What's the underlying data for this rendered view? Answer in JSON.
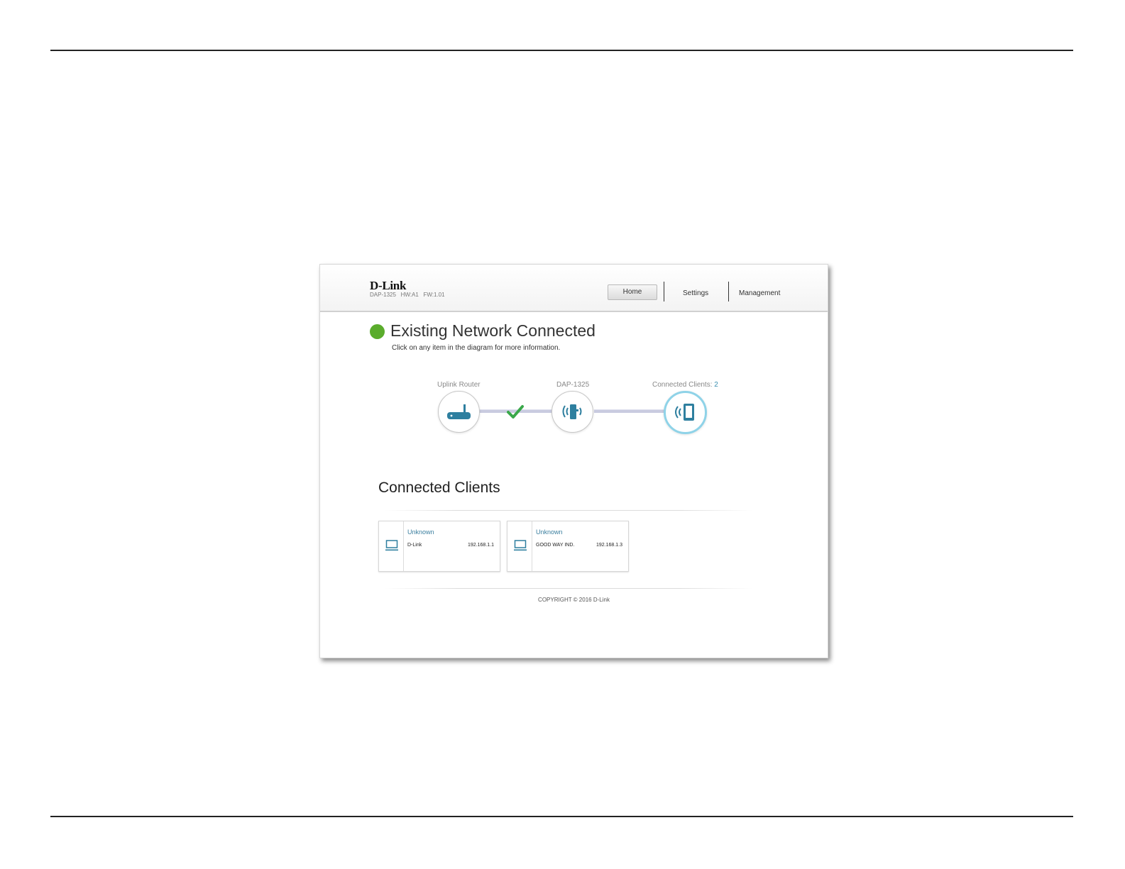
{
  "brand": {
    "logo": "D-Link",
    "model": "DAP-1325",
    "hw": "HW:A1",
    "fw": "FW:1.01"
  },
  "nav": {
    "home": "Home",
    "settings": "Settings",
    "management": "Management"
  },
  "status": {
    "title": "Existing Network Connected",
    "subtitle": "Click on any item in the diagram for more information.",
    "color": "#5aac2c"
  },
  "diagram": {
    "uplink_label": "Uplink Router",
    "device_label": "DAP-1325",
    "clients_label": "Connected Clients: ",
    "clients_count": "2",
    "accent_color": "#3b7f9f"
  },
  "clients": {
    "title": "Connected Clients",
    "items": [
      {
        "name": "Unknown",
        "vendor": "D-Link",
        "ip": "192.168.1.1"
      },
      {
        "name": "Unknown",
        "vendor": "GOOD WAY IND.",
        "ip": "192.168.1.3"
      }
    ]
  },
  "footer": {
    "copyright": "COPYRIGHT © 2016 D-Link"
  }
}
